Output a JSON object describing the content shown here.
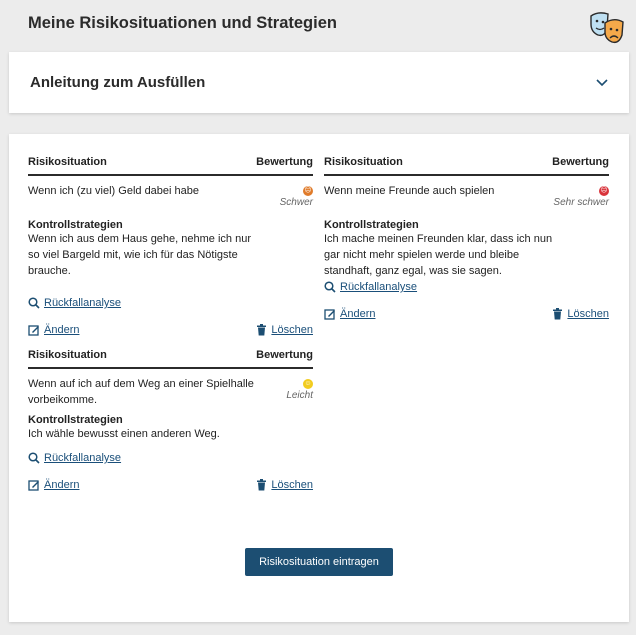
{
  "page": {
    "title": "Meine Risikosituationen und Strategien"
  },
  "accordion": {
    "title": "Anleitung zum Ausfüllen"
  },
  "cards": [
    {
      "col_situation": "Risikosituation",
      "col_rating": "Bewertung",
      "situation": "Wenn ich (zu viel) Geld dabei habe",
      "rating": "Schwer",
      "rating_color": "#e07b2a",
      "strategies_title": "Kontrollstrategien",
      "strategies": "Wenn ich aus dem Haus gehe, nehme ich nur so viel Bargeld mit, wie ich für das Nötigste brauche.",
      "analysis_link": "Rückfallanalyse",
      "edit_link": "Ändern",
      "delete_link": "Löschen"
    },
    {
      "col_situation": "Risikosituation",
      "col_rating": "Bewertung",
      "situation": "Wenn meine Freunde auch spielen",
      "rating": "Sehr schwer",
      "rating_color": "#d9343b",
      "strategies_title": "Kontrollstrategien",
      "strategies": "Ich mache meinen Freunden klar, dass ich nun gar nicht mehr spielen werde und bleibe standhaft, ganz egal, was sie sagen.",
      "analysis_link": "Rückfallanalyse",
      "edit_link": "Ändern",
      "delete_link": "Löschen"
    },
    {
      "col_situation": "Risikosituation",
      "col_rating": "Bewertung",
      "situation": "Wenn auf ich auf dem Weg an einer Spielhalle vorbeikomme.",
      "rating": "Leicht",
      "rating_color": "#f2cc1f",
      "strategies_title": "Kontrollstrategien",
      "strategies": "Ich wähle bewusst einen anderen Weg.",
      "analysis_link": "Rückfallanalyse",
      "edit_link": "Ändern",
      "delete_link": "Löschen"
    }
  ],
  "cta": {
    "label": "Risikosituation eintragen"
  }
}
